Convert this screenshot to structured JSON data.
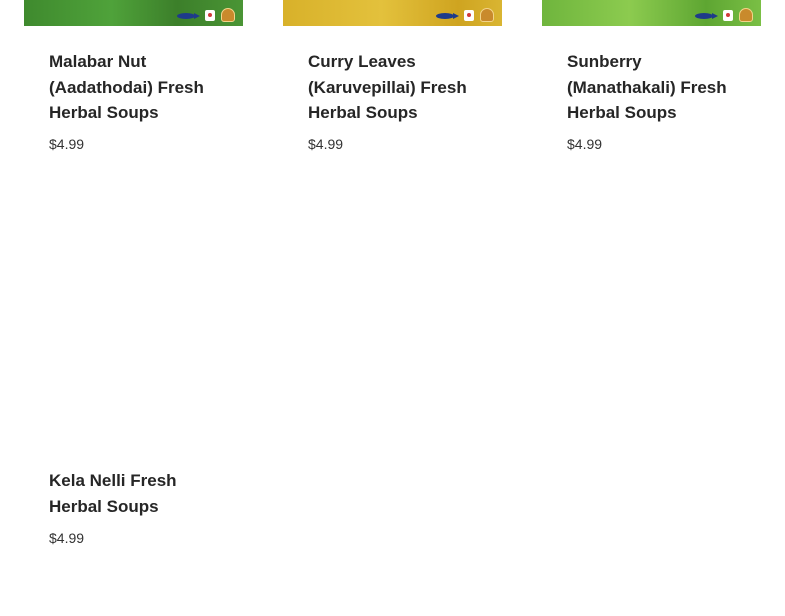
{
  "products": [
    {
      "title_lines": [
        "Malabar Nut",
        "(Aadathodai) Fresh",
        "Herbal Soups"
      ],
      "price": "$4.99",
      "image": {
        "icons": [
          "fish-icon",
          "shirt-icon",
          "badge-icon"
        ]
      }
    },
    {
      "title_lines": [
        "Curry Leaves",
        "(Karuvepillai) Fresh",
        "Herbal Soups"
      ],
      "price": "$4.99",
      "image": {
        "icons": [
          "fish-icon",
          "shirt-icon",
          "badge-icon"
        ]
      }
    },
    {
      "title_lines": [
        "Sunberry",
        "(Manathakali) Fresh",
        "Herbal Soups"
      ],
      "price": "$4.99",
      "image": {
        "icons": [
          "fish-icon",
          "shirt-icon",
          "badge-icon"
        ]
      }
    },
    {
      "title_lines": [
        "Kela Nelli Fresh",
        "Herbal Soups"
      ],
      "price": "$4.99"
    }
  ]
}
